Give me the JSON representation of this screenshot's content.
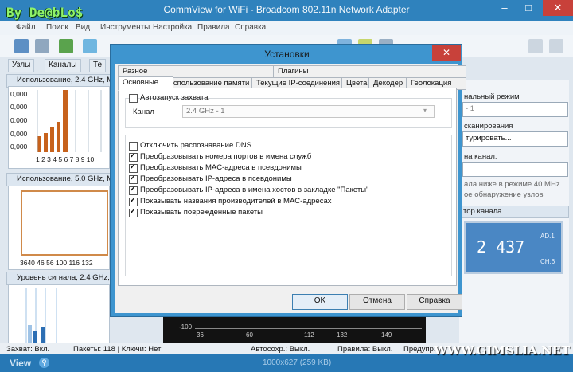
{
  "watermark": "By De@bLo$",
  "window": {
    "title": "CommView for WiFi - Broadcom 802.11n Network Adapter",
    "min": "–",
    "max": "□",
    "close": "✕"
  },
  "menu": [
    "Файл",
    "Поиск",
    "Вид",
    "Инструменты",
    "Настройка",
    "Правила",
    "Справка"
  ],
  "left_tabs": [
    "Узлы",
    "Каналы",
    "Те"
  ],
  "left_sections": [
    {
      "title": "Использование, 2.4 GHz, МБ",
      "yticks": [
        "0,000",
        "0,000",
        "0,000",
        "0,000",
        "0,000"
      ],
      "xticks": "1 2 3 4 5 6 7 8 9 10"
    },
    {
      "title": "Использование, 5.0 GHz, МБ",
      "xticks": "3640 46 56 100 116 132"
    },
    {
      "title": "Уровень сигнала, 2.4 GHz, dB"
    }
  ],
  "right_panel": {
    "mode_label": "нальный режим",
    "mode_value": "- 1",
    "scan_label": "сканирования",
    "scan_value": "турировать...",
    "channel_label": "на канал:",
    "note1": "ала ниже в режиме 40 MHz",
    "note2": "ое обнаружение узлов",
    "monitor_label": "тор канала",
    "lcd_freq": "2 437",
    "lcd_mode": "AD.1",
    "lcd_ch": "CH.6"
  },
  "bottom_graph": {
    "ylabel": "-100",
    "xticks": [
      "36",
      "60",
      "112",
      "132",
      "149"
    ]
  },
  "status": {
    "capture": "Захват: Вкл.",
    "packets": "Пакеты: 118 | Ключи: Нет",
    "autosave": "Автосохр.: Выкл.",
    "rules": "Правила: Выкл.",
    "warn": "Предупр."
  },
  "footer": {
    "view": "View",
    "size": "1000x627 (259 KB)",
    "site": "WWW.GIMSLIA.NET"
  },
  "dialog": {
    "title": "Установки",
    "close": "✕",
    "tabs_row1": [
      "Разное",
      "Плагины"
    ],
    "tabs_row2": [
      "Основные",
      "Использование памяти",
      "Текущие IP-соединения",
      "Цвета",
      "Декодер",
      "Геолокация"
    ],
    "autostart": {
      "label": "Автозапуск захвата",
      "checked": false
    },
    "channel_label": "Канал",
    "channel_value": "2.4 GHz - 1",
    "options": [
      {
        "label": "Отключить распознавание DNS",
        "checked": false
      },
      {
        "label": "Преобразовывать номера портов в имена служб",
        "checked": true
      },
      {
        "label": "Преобразовывать MAC-адреса в псевдонимы",
        "checked": true
      },
      {
        "label": "Преобразовывать IP-адреса в псевдонимы",
        "checked": true
      },
      {
        "label": "Преобразовывать IP-адреса в имена хостов в закладке \"Пакеты\"",
        "checked": true
      },
      {
        "label": "Показывать названия производителей в MAC-адресах",
        "checked": true
      },
      {
        "label": "Показывать поврежденные пакеты",
        "checked": true
      }
    ],
    "buttons": {
      "ok": "OK",
      "cancel": "Отмена",
      "help": "Справка"
    }
  }
}
